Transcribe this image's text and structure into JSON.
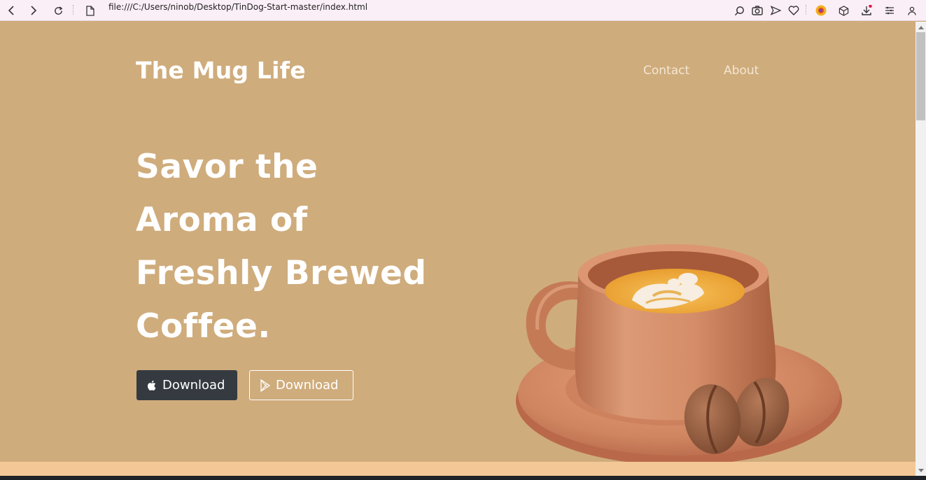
{
  "browser": {
    "url": "file:///C:/Users/ninob/Desktop/TinDog-Start-master/index.html",
    "icons": [
      "back-icon",
      "forward-icon",
      "reload-icon",
      "page-icon",
      "search-icon",
      "camera-icon",
      "send-icon",
      "heart-icon",
      "extension-icon",
      "box-icon",
      "download-icon",
      "menu-icon",
      "profile-icon"
    ]
  },
  "header": {
    "brand": "The Mug Life",
    "nav": [
      {
        "label": "Contact"
      },
      {
        "label": "About"
      }
    ]
  },
  "hero": {
    "headline_lines": [
      "Savor the",
      "Aroma of",
      "Freshly Brewed",
      "Coffee."
    ],
    "buttons": [
      {
        "label": "Download",
        "icon": "apple-icon",
        "style": "dark"
      },
      {
        "label": "Download",
        "icon": "google-play-icon",
        "style": "outline"
      }
    ],
    "image": "coffee-cup-illustration"
  },
  "colors": {
    "background": "#cfac7c",
    "strip": "#f3c896",
    "dark_button": "#343a40",
    "text": "#ffffff"
  }
}
